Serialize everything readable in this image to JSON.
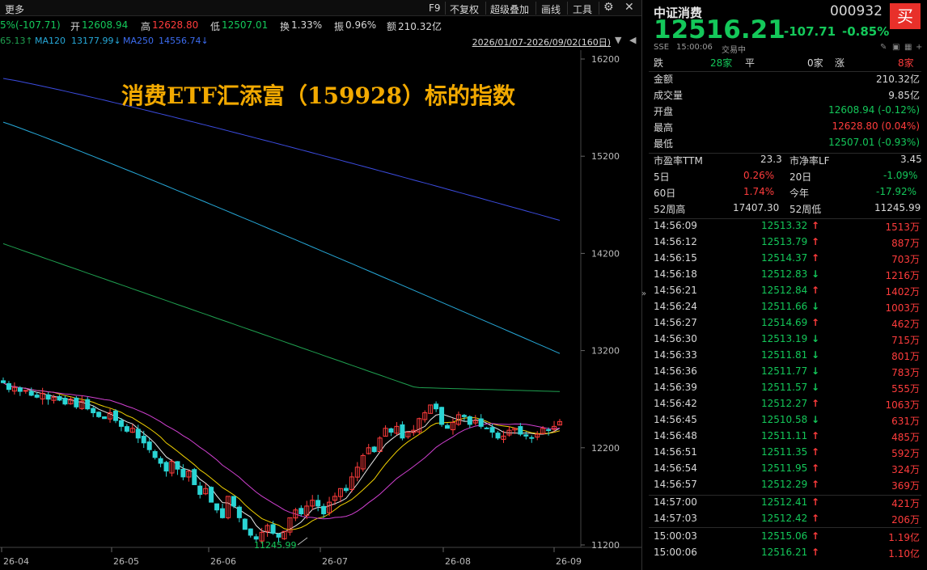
{
  "toolbar": {
    "more": "更多",
    "f9": "F9",
    "no_adjust": "不复权",
    "overlay": "超级叠加",
    "draw": "画线",
    "tools": "工具"
  },
  "ohlc": {
    "chg_pct_partial": "5%(-107.71)",
    "open_label": "开",
    "open": "12608.94",
    "high_label": "高",
    "high": "12628.80",
    "low_label": "低",
    "low": "12507.01",
    "turnover_label": "换",
    "turnover": "1.33%",
    "amp_label": "振",
    "amp": "0.96%",
    "amount_label": "额",
    "amount": "210.32亿"
  },
  "ma": {
    "partial": "65.13↑",
    "ma120_label": "MA120",
    "ma120": "13177.99↓",
    "ma250_label": "MA250",
    "ma250": "14556.74↓",
    "range": "2026/01/07-2026/09/02(160日)"
  },
  "chart_data": {
    "type": "candlestick",
    "title": "消费ETF汇添富（159928）标的指数",
    "y_ticks": [
      "16200",
      "15200",
      "14200",
      "13200",
      "12200",
      "11200"
    ],
    "ylim": [
      11200,
      16200
    ],
    "x_ticks": [
      "26-04",
      "26-05",
      "26-06",
      "26-07",
      "26-08",
      "26-09"
    ],
    "min_label": "11245.99",
    "approx_close_series": [
      12870,
      12800,
      12820,
      12780,
      12790,
      12740,
      12720,
      12760,
      12700,
      12720,
      12690,
      12650,
      12700,
      12620,
      12680,
      12600,
      12560,
      12520,
      12500,
      12560,
      12480,
      12420,
      12370,
      12400,
      12300,
      12250,
      12180,
      12100,
      12040,
      11960,
      12060,
      11980,
      11900,
      11960,
      11820,
      11720,
      11780,
      11640,
      11560,
      11480,
      11700,
      11600,
      11480,
      11360,
      11300,
      11260,
      11330,
      11400,
      11320,
      11280,
      11340,
      11480,
      11560,
      11520,
      11600,
      11660,
      11600,
      11520,
      11640,
      11700,
      11780,
      11760,
      11900,
      12000,
      12120,
      12200,
      12160,
      12300,
      12400,
      12360,
      12420,
      12300,
      12360,
      12380,
      12500,
      12560,
      12640,
      12600,
      12440,
      12400,
      12460,
      12540,
      12520,
      12440,
      12480,
      12420,
      12400,
      12360,
      12300,
      12320,
      12380,
      12400,
      12340,
      12320,
      12300,
      12340,
      12400,
      12380,
      12420,
      12470
    ]
  },
  "quote": {
    "name": "中证消费",
    "code": "000932",
    "buy": "买",
    "price": "12516.21",
    "change": "-107.71",
    "change_pct": "-0.85%",
    "exchange": "SSE",
    "time": "15:00:06",
    "status": "交易中",
    "down_label": "跌",
    "down_count": "28家",
    "flat_label": "平",
    "flat_count": "0家",
    "up_label": "涨",
    "up_count": "8家"
  },
  "stats": [
    {
      "label": "金额",
      "value": "210.32亿",
      "color": "#d8d8d8"
    },
    {
      "label": "成交量",
      "value": "9.85亿",
      "color": "#d8d8d8"
    },
    {
      "label": "开盘",
      "value": "12608.94 (-0.12%)",
      "color": "#14c85a"
    },
    {
      "label": "最高",
      "value": "12628.80 (0.04%)",
      "color": "#ff3c3c"
    },
    {
      "label": "最低",
      "value": "12507.01 (-0.93%)",
      "color": "#14c85a"
    }
  ],
  "valuation": {
    "pe_label": "市盈率TTM",
    "pe": "23.3",
    "pb_label": "市净率LF",
    "pb": "3.45",
    "d5_label": "5日",
    "d5": "0.26%",
    "d20_label": "20日",
    "d20": "-1.09%",
    "d60_label": "60日",
    "d60": "1.74%",
    "ytd_label": "今年",
    "ytd": "-17.92%",
    "h52_label": "52周高",
    "h52": "17407.30",
    "l52_label": "52周低",
    "l52": "11245.99"
  },
  "ticks": [
    {
      "time": "14:56:09",
      "price": "12513.32",
      "dir": "up",
      "vol": "1513万"
    },
    {
      "time": "14:56:12",
      "price": "12513.79",
      "dir": "up",
      "vol": "887万"
    },
    {
      "time": "14:56:15",
      "price": "12514.37",
      "dir": "up",
      "vol": "703万"
    },
    {
      "time": "14:56:18",
      "price": "12512.83",
      "dir": "down",
      "vol": "1216万"
    },
    {
      "time": "14:56:21",
      "price": "12512.84",
      "dir": "up",
      "vol": "1402万"
    },
    {
      "time": "14:56:24",
      "price": "12511.66",
      "dir": "down",
      "vol": "1003万"
    },
    {
      "time": "14:56:27",
      "price": "12514.69",
      "dir": "up",
      "vol": "462万"
    },
    {
      "time": "14:56:30",
      "price": "12513.19",
      "dir": "down",
      "vol": "715万"
    },
    {
      "time": "14:56:33",
      "price": "12511.81",
      "dir": "down",
      "vol": "801万"
    },
    {
      "time": "14:56:36",
      "price": "12511.77",
      "dir": "down",
      "vol": "783万"
    },
    {
      "time": "14:56:39",
      "price": "12511.57",
      "dir": "down",
      "vol": "555万"
    },
    {
      "time": "14:56:42",
      "price": "12512.27",
      "dir": "up",
      "vol": "1063万"
    },
    {
      "time": "14:56:45",
      "price": "12510.58",
      "dir": "down",
      "vol": "631万"
    },
    {
      "time": "14:56:48",
      "price": "12511.11",
      "dir": "up",
      "vol": "485万"
    },
    {
      "time": "14:56:51",
      "price": "12511.35",
      "dir": "up",
      "vol": "592万"
    },
    {
      "time": "14:56:54",
      "price": "12511.95",
      "dir": "up",
      "vol": "324万"
    },
    {
      "time": "14:56:57",
      "price": "12512.29",
      "dir": "up",
      "vol": "369万"
    },
    {
      "time": "14:57:00",
      "price": "12512.41",
      "dir": "up",
      "vol": "421万"
    },
    {
      "time": "14:57:03",
      "price": "12512.42",
      "dir": "up",
      "vol": "206万"
    },
    {
      "time": "15:00:03",
      "price": "12515.06",
      "dir": "up",
      "vol": "1.19亿"
    },
    {
      "time": "15:00:06",
      "price": "12516.21",
      "dir": "up",
      "vol": "1.10亿"
    }
  ],
  "colors": {
    "up": "#ff3c3c",
    "down": "#14c85a",
    "title": "#f2a900",
    "ma5": "#e8e8e8",
    "ma10": "#f0d000",
    "ma20": "#d040d0",
    "ma60": "#1fa050",
    "ma120": "#26a8d8",
    "ma250": "#3c4ce0"
  }
}
